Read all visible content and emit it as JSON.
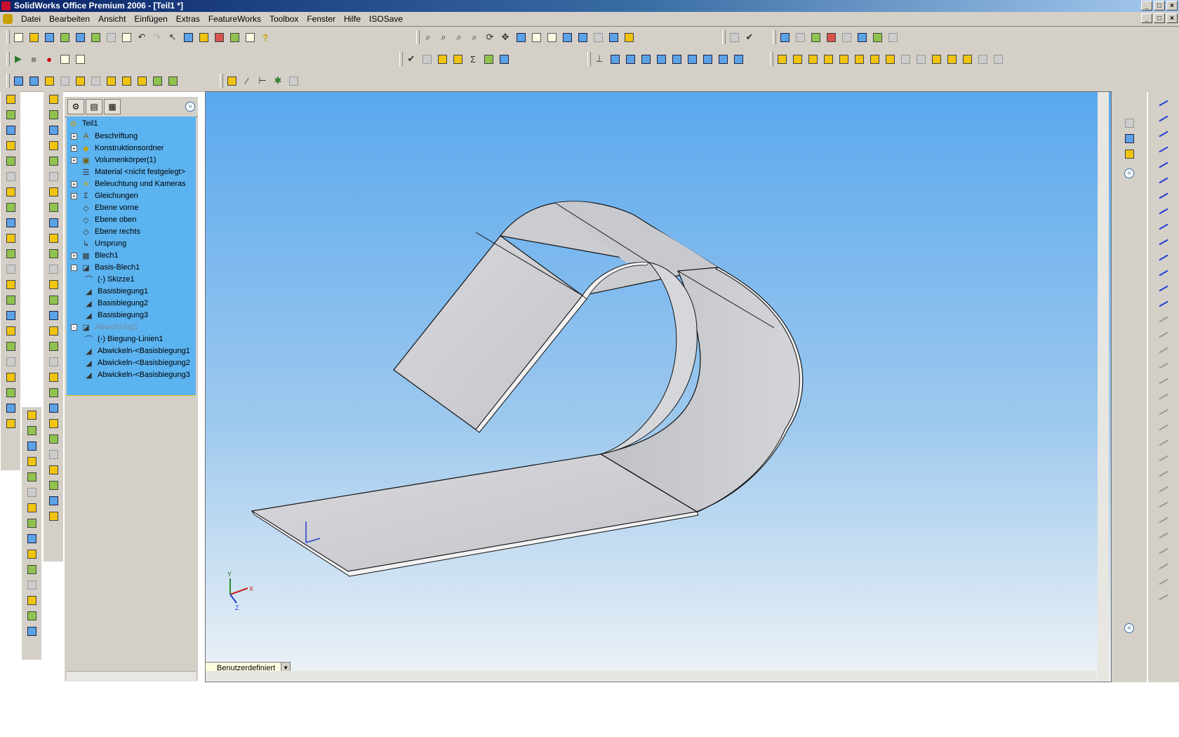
{
  "window": {
    "title": "SolidWorks Office Premium 2006 - [Teil1 *]"
  },
  "menu": {
    "items": [
      "Datei",
      "Bearbeiten",
      "Ansicht",
      "Einfügen",
      "Extras",
      "FeatureWorks",
      "Toolbox",
      "Fenster",
      "Hilfe",
      "ISOSave"
    ]
  },
  "tree": {
    "root": "Teil1",
    "nodes": [
      {
        "label": "Beschriftung",
        "icon": "annotation-icon",
        "expand": "+"
      },
      {
        "label": "Konstruktionsordner",
        "icon": "design-folder-icon",
        "expand": "+"
      },
      {
        "label": "Volumenkörper(1)",
        "icon": "solid-bodies-icon",
        "expand": "+"
      },
      {
        "label": "Material <nicht festgelegt>",
        "icon": "material-icon",
        "expand": ""
      },
      {
        "label": "Beleuchtung und Kameras",
        "icon": "lighting-icon",
        "expand": "+"
      },
      {
        "label": "Gleichungen",
        "icon": "equations-icon",
        "expand": "+"
      },
      {
        "label": "Ebene vorne",
        "icon": "plane-icon",
        "expand": ""
      },
      {
        "label": "Ebene oben",
        "icon": "plane-icon",
        "expand": ""
      },
      {
        "label": "Ebene rechts",
        "icon": "plane-icon",
        "expand": ""
      },
      {
        "label": "Ursprung",
        "icon": "origin-icon",
        "expand": ""
      },
      {
        "label": "Blech1",
        "icon": "sheet-metal-icon",
        "expand": "+"
      },
      {
        "label": "Basis-Blech1",
        "icon": "base-flange-icon",
        "expand": "-"
      },
      {
        "label": "(-) Skizze1",
        "icon": "sketch-icon",
        "expand": ""
      },
      {
        "label": "Basisbiegung1",
        "icon": "bend-icon",
        "expand": ""
      },
      {
        "label": "Basisbiegung2",
        "icon": "bend-icon",
        "expand": ""
      },
      {
        "label": "Basisbiegung3",
        "icon": "bend-icon",
        "expand": ""
      },
      {
        "label": "Abwicklung1",
        "icon": "flat-pattern-icon",
        "expand": "-"
      },
      {
        "label": "(-) Biegung-Linien1",
        "icon": "sketch-icon",
        "expand": ""
      },
      {
        "label": "Abwickeln-<Basisbiegung1",
        "icon": "bend-icon",
        "expand": ""
      },
      {
        "label": "Abwickeln-<Basisbiegung2",
        "icon": "bend-icon",
        "expand": ""
      },
      {
        "label": "Abwickeln-<Basisbiegung3",
        "icon": "bend-icon",
        "expand": ""
      }
    ]
  },
  "viewport": {
    "view_combo": "Benutzerdefiniert"
  },
  "triad": {
    "x": "X",
    "y": "Y",
    "z": "Z"
  },
  "colors": {
    "tree_bg": "#5bb3f0",
    "viewport_top": "#5aa8ee",
    "viewport_bottom": "#eef2f6",
    "part_fill": "#cfd0d4"
  }
}
